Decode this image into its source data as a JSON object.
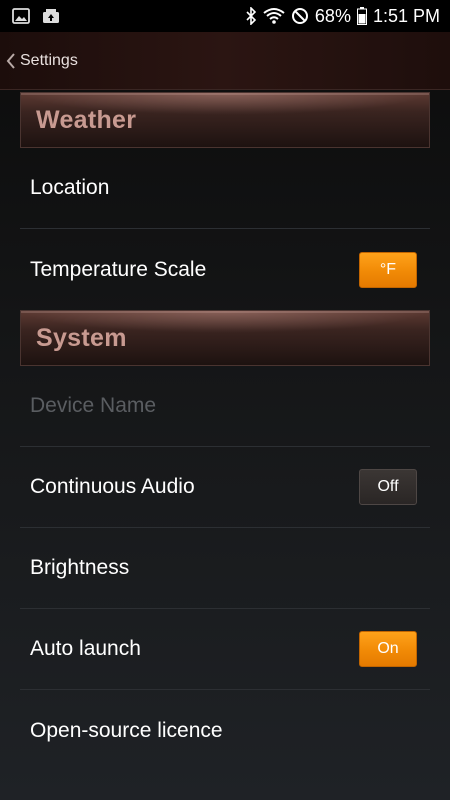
{
  "status_bar": {
    "battery_percent": "68%",
    "time": "1:51 PM",
    "icons": [
      "image-notification-icon",
      "photo-upload-icon",
      "bluetooth-icon",
      "wifi-icon",
      "do-not-disturb-icon",
      "battery-icon"
    ]
  },
  "header": {
    "back_label": "Settings"
  },
  "sections": {
    "weather": {
      "title": "Weather",
      "location_label": "Location",
      "temperature_scale_label": "Temperature Scale",
      "temperature_scale_value": "°F"
    },
    "system": {
      "title": "System",
      "device_name_label": "Device Name",
      "continuous_audio_label": "Continuous Audio",
      "continuous_audio_value": "Off",
      "brightness_label": "Brightness",
      "auto_launch_label": "Auto launch",
      "auto_launch_value": "On",
      "open_source_label": "Open-source licence"
    }
  },
  "colors": {
    "accent_orange": "#f18a06",
    "section_title": "#c89a91",
    "disabled_text": "#5a5d61"
  }
}
